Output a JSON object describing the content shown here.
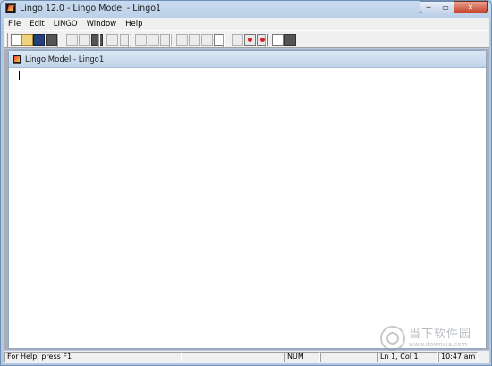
{
  "window": {
    "title": "Lingo 12.0 - Lingo Model - Lingo1",
    "min_glyph": "─",
    "max_glyph": "▭",
    "close_glyph": "✕"
  },
  "menubar": {
    "items": [
      "File",
      "Edit",
      "LINGO",
      "Window",
      "Help"
    ]
  },
  "toolbar": {
    "icons": [
      {
        "name": "new-icon",
        "style": ""
      },
      {
        "name": "open-icon",
        "style": "folder"
      },
      {
        "name": "save-icon",
        "style": "save"
      },
      {
        "name": "print-icon",
        "style": "dark"
      },
      {
        "name": "cut-icon",
        "style": "gray"
      },
      {
        "name": "copy-icon",
        "style": "gray"
      },
      {
        "name": "paste-icon",
        "style": "dark"
      },
      {
        "name": "undo-icon",
        "style": "gray"
      },
      {
        "name": "redo-icon",
        "style": "gray"
      },
      {
        "name": "find-icon",
        "style": "gray"
      },
      {
        "name": "goto-line-icon",
        "style": "gray"
      },
      {
        "name": "match-parenthesis-icon",
        "style": "gray"
      },
      {
        "name": "solve-icon",
        "style": "gray"
      },
      {
        "name": "solution-icon",
        "style": "gray"
      },
      {
        "name": "stop-icon",
        "style": "gray"
      },
      {
        "name": "close-all-icon",
        "style": ""
      },
      {
        "name": "send-to-back-icon",
        "style": "gray"
      },
      {
        "name": "tile-icon",
        "style": "red"
      },
      {
        "name": "cascade-icon",
        "style": "red"
      },
      {
        "name": "help-topics-icon",
        "style": ""
      },
      {
        "name": "context-help-icon",
        "style": "dark"
      }
    ]
  },
  "document": {
    "title": "Lingo Model - Lingo1",
    "content": ""
  },
  "statusbar": {
    "help_text": "For Help, press F1",
    "num_indicator": "NUM",
    "position": "Ln 1, Col 1",
    "time": "10:47 am"
  },
  "watermark": {
    "name": "当下软件园",
    "url": "www.downxia.com"
  }
}
